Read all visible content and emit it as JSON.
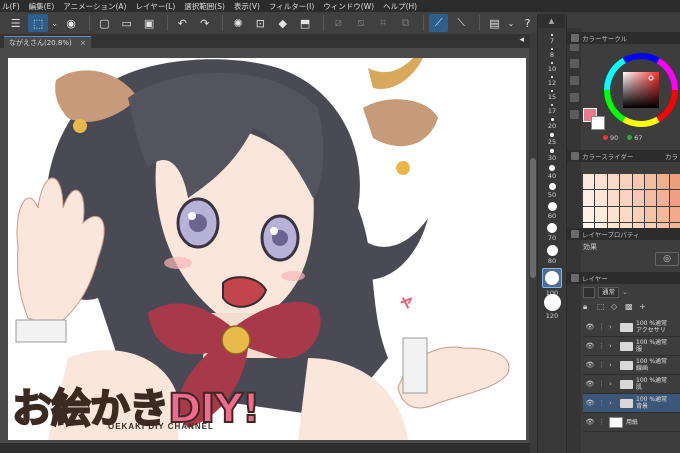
{
  "menubar": {
    "items": [
      "ル(F)",
      "編集(E)",
      "アニメーション(A)",
      "レイヤー(L)",
      "選択範囲(S)",
      "表示(V)",
      "フィルター(I)",
      "ウィンドウ(W)",
      "ヘルプ(H)"
    ]
  },
  "document_tab": {
    "label": "ながえさん(20.8%)",
    "close": "×",
    "collapse": "◂"
  },
  "brush_sizes": {
    "values": [
      "7",
      "8",
      "10",
      "12",
      "15",
      "17",
      "20",
      "25",
      "30",
      "40",
      "50",
      "60",
      "70",
      "80",
      "100",
      "120"
    ],
    "selected": "100"
  },
  "color_panel": {
    "title": "カラーサークル",
    "main_color": "#e87a8e",
    "sub_color": "#ffffff",
    "hsv": [
      "90",
      "67"
    ]
  },
  "color_slider_panel": {
    "title": "カラースライダー",
    "tab2": "カラ"
  },
  "layer_property_panel": {
    "title": "レイヤープロパティ",
    "effect_label": "効果"
  },
  "layer_panel": {
    "title": "レイヤー",
    "blend_mode": "通常",
    "layers": [
      {
        "opacity": "100 %通常",
        "name": "アクセサリ",
        "type": "folder",
        "selected": false
      },
      {
        "opacity": "100 %通常",
        "name": "服",
        "type": "folder",
        "selected": false
      },
      {
        "opacity": "100 %通常",
        "name": "線画",
        "type": "folder",
        "selected": false
      },
      {
        "opacity": "100 %通常",
        "name": "肌",
        "type": "folder",
        "selected": false
      },
      {
        "opacity": "100 %通常",
        "name": "背景",
        "type": "folder",
        "selected": true
      },
      {
        "opacity": "",
        "name": "用紙",
        "type": "paper",
        "selected": false
      }
    ]
  },
  "artwork": {
    "logo_text": "お絵かきDIY!",
    "logo_subtitle": "OEKAKI DIY CHANNEL",
    "sfx_text": "ャ"
  }
}
